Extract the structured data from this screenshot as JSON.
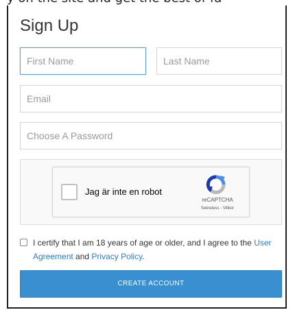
{
  "top_cutoff_text": "y on the site and get the best of fa",
  "title": "Sign Up",
  "form": {
    "first_name_placeholder": "First Name",
    "last_name_placeholder": "Last Name",
    "email_placeholder": "Email",
    "password_placeholder": "Choose A Password"
  },
  "captcha": {
    "label": "Jag är inte en robot",
    "brand": "reCAPTCHA",
    "privacy_link": "Sekretess",
    "separator": " - ",
    "terms_link": "Villkor",
    "checked": false
  },
  "terms": {
    "checked": false,
    "text_before": "I certify that I am 18 years of age or older, and I agree to the ",
    "user_agreement_link": "User Agreement",
    "text_middle": " and ",
    "privacy_policy_link": "Privacy Policy",
    "text_after": "."
  },
  "submit_label": "CREATE ACCOUNT",
  "colors": {
    "accent": "#3a8fd1",
    "link": "#2e7cc4",
    "focus_border": "#5a9fd6"
  }
}
